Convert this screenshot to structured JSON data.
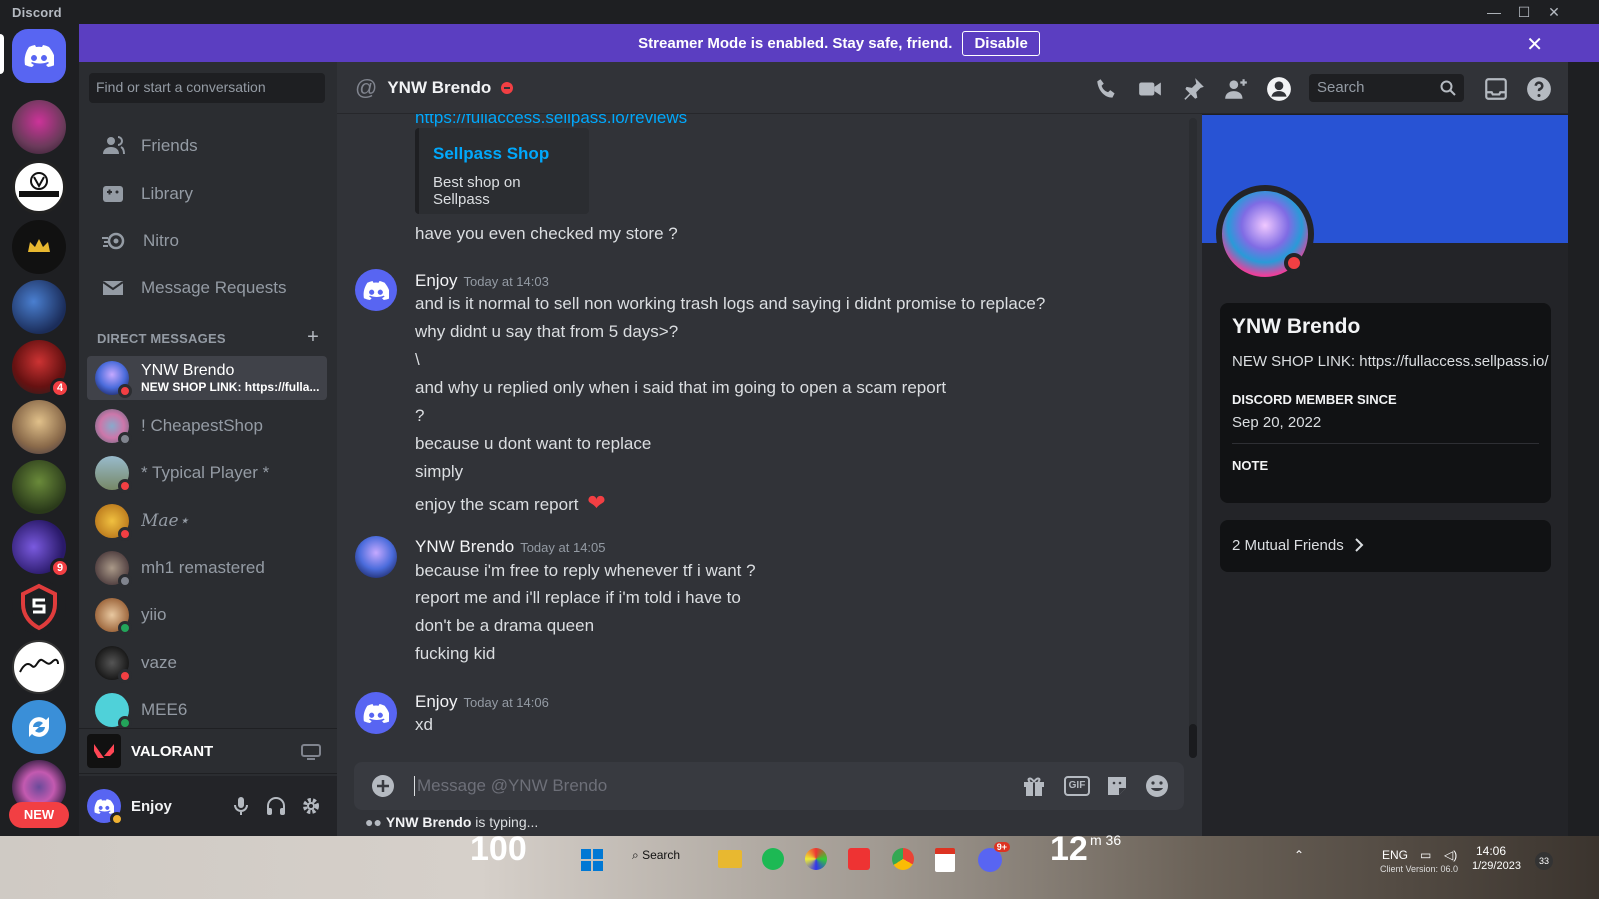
{
  "window": {
    "title": "Discord",
    "minimize": "—",
    "maximize": "☐",
    "close": "✕"
  },
  "banner": {
    "text": "Streamer Mode is enabled. Stay safe, friend.",
    "button": "Disable",
    "close": "✕"
  },
  "guilds": {
    "badges": {
      "g4": "4",
      "g7": "9"
    },
    "new_label": "NEW"
  },
  "sidebar": {
    "search_placeholder": "Find or start a conversation",
    "nav": [
      {
        "label": "Friends"
      },
      {
        "label": "Library"
      },
      {
        "label": "Nitro"
      },
      {
        "label": "Message Requests"
      }
    ],
    "dm_header": "DIRECT MESSAGES",
    "dm_add": "+",
    "dms": [
      {
        "name": "YNW Brendo",
        "sub": "NEW SHOP LINK: https://fulla..."
      },
      {
        "name": "! CheapestShop"
      },
      {
        "name": "* Typical Player *"
      },
      {
        "name": "𝑀𝑎𝑒⋆"
      },
      {
        "name": "mh1 remastered"
      },
      {
        "name": "yiio"
      },
      {
        "name": "vaze"
      },
      {
        "name": "MEE6"
      }
    ],
    "activity": "VALORANT",
    "user": "Enjoy"
  },
  "chat": {
    "at": "@",
    "recipient": "YNW Brendo",
    "search": "Search",
    "link": "https://fullaccess.sellpass.io/reviews",
    "embed": {
      "title": "Sellpass Shop",
      "description": "Best shop on Sellpass"
    },
    "intro_line": "have you even checked my store ?",
    "groups": [
      {
        "author": "Enjoy",
        "time": "Today at 14:03",
        "lines": [
          "and is it normal to sell non working trash logs and saying i didnt promise to replace?",
          "why didnt u say that from 5 days>?",
          "\\",
          "and why u replied only when i said that im going to open a scam report",
          "?",
          "because u dont want to replace",
          "simply",
          "enjoy the scam report"
        ]
      },
      {
        "author": "YNW Brendo",
        "time": "Today at 14:05",
        "lines": [
          "because i'm free to reply whenever tf i want ?",
          "report me and i'll replace if i'm told i have to",
          "don't be a drama queen",
          "fucking kid"
        ]
      },
      {
        "author": "Enjoy",
        "time": "Today at 14:06",
        "lines": [
          "xd"
        ]
      }
    ],
    "heart": "❤",
    "composer_placeholder": "Message @YNW Brendo",
    "composer_gif": "GIF",
    "typing_user": "YNW Brendo",
    "typing_suffix": " is typing..."
  },
  "profile": {
    "name": "YNW Brendo",
    "bio": "NEW SHOP LINK: https://fullaccess.sellpass.io/",
    "member_since_label": "DISCORD MEMBER SINCE",
    "member_since": "Sep 20, 2022",
    "note_label": "NOTE",
    "mutual": "2 Mutual Friends"
  },
  "taskbar": {
    "weather_left": "100",
    "weather_right": "12",
    "weather_small": "m 36",
    "search": "Search",
    "lang": "ENG",
    "date": "1/29/2023",
    "time": "14:06",
    "discord_badge": "9+",
    "notif": "33",
    "watermark": "Client Version: 06.0"
  },
  "colors": {
    "accent": "#5865f2",
    "streamer_banner": "#5b3ec1",
    "dnd": "#f23f43",
    "online": "#23a55a",
    "link": "#00a8fc",
    "profile_banner": "#2853d4"
  }
}
